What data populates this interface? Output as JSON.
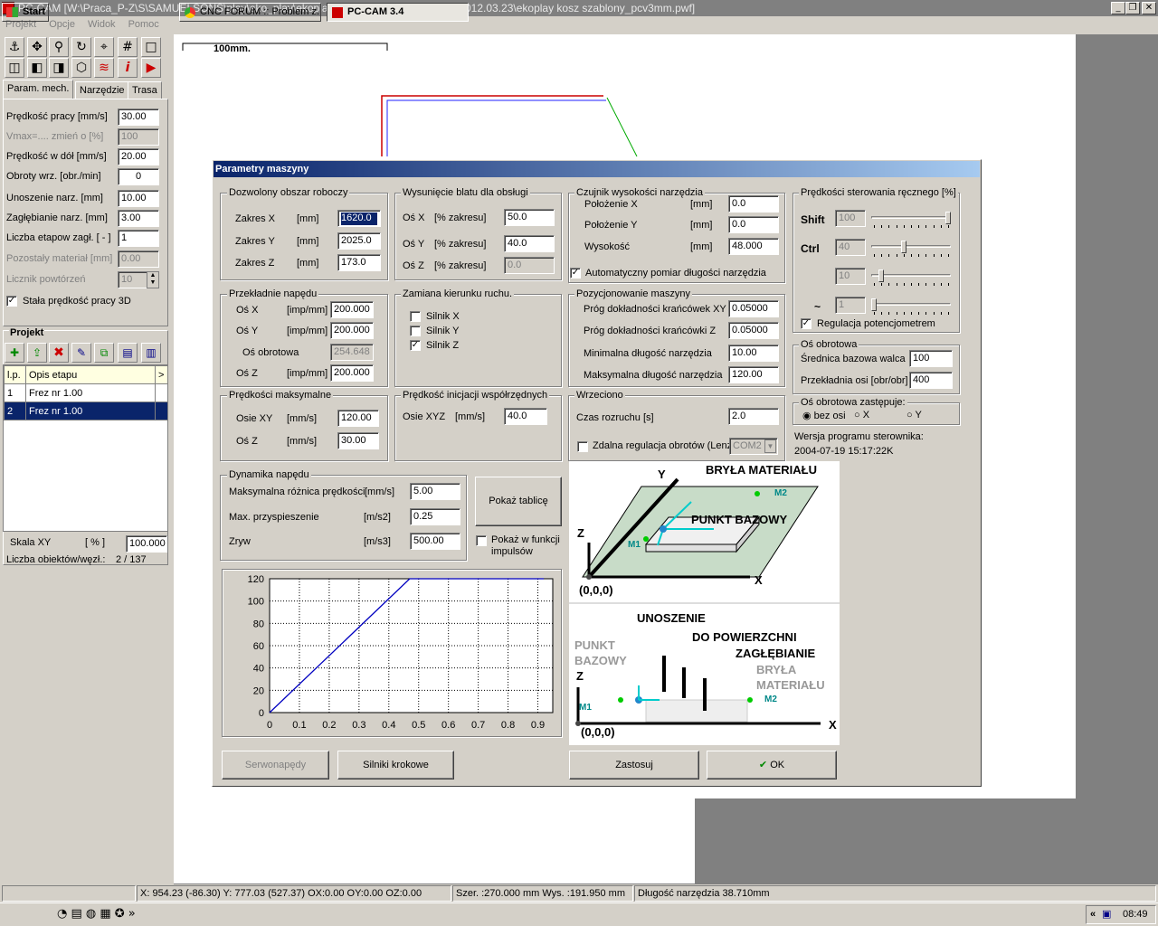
{
  "window": {
    "title": "PC-CAM  [W:\\Praca_P-Z\\S\\SAMUELSONS\\play\\eko_play\\ekoplay_kosz_dibond\\frezowanie\\2012.03.23\\ekoplay kosz szablony_pcv3mm.pwf]"
  },
  "menu": [
    "Projekt",
    "Opcje",
    "Widok",
    "Pomoc"
  ],
  "left_tabs": [
    "Param. mech.",
    "Narzędzie",
    "Trasa"
  ],
  "params": [
    {
      "label": "Prędkość pracy   [mm/s]",
      "value": "30.00",
      "disabled": false
    },
    {
      "label": "Vmax=....   zmień o [%]",
      "value": "100",
      "disabled": true
    },
    {
      "label": "Prędkość w dół   [mm/s]",
      "value": "20.00",
      "disabled": false
    },
    {
      "label": "Obroty wrz.   [obr./min]",
      "value": "0",
      "disabled": false
    },
    {
      "label": "Unoszenie narz.    [mm]",
      "value": "10.00",
      "disabled": false
    },
    {
      "label": "Zagłębianie narz.   [mm]",
      "value": "3.00",
      "disabled": false
    },
    {
      "label": "Liczba etapow zagł. [ - ]",
      "value": "1",
      "disabled": false
    },
    {
      "label": "Pozostały materiał  [mm]",
      "value": "0.00",
      "disabled": true
    },
    {
      "label": "Licznik powtórzeń",
      "value": "10",
      "disabled": true
    }
  ],
  "const_speed_label": "Stała prędkość pracy 3D",
  "project": {
    "title": "Projekt",
    "col_lp": "l.p.",
    "col_desc": "Opis etapu",
    "col_more": ">",
    "rows": [
      {
        "lp": "1",
        "desc": "Frez nr 1.00"
      },
      {
        "lp": "2",
        "desc": "Frez nr 1.00"
      }
    ]
  },
  "scale": {
    "label": "Skala XY",
    "unit": "[ % ]",
    "value": "100.000"
  },
  "objects": {
    "label": "Liczba obiektów/węzł.:",
    "value": "2 /    137"
  },
  "ruler": "100mm.",
  "dialog": {
    "title": "Parametry maszyny",
    "workarea": {
      "title": "Dozwolony obszar roboczy",
      "rows": [
        {
          "label": "Zakres X",
          "unit": "[mm]",
          "value": "1620.0"
        },
        {
          "label": "Zakres Y",
          "unit": "[mm]",
          "value": "2025.0"
        },
        {
          "label": "Zakres Z",
          "unit": "[mm]",
          "value": "173.0"
        }
      ]
    },
    "table": {
      "title": "Wysunięcie blatu dla obsługi",
      "rows": [
        {
          "label": "Oś X",
          "unit": "[% zakresu]",
          "value": "50.0",
          "disabled": false
        },
        {
          "label": "Oś Y",
          "unit": "[% zakresu]",
          "value": "40.0",
          "disabled": false
        },
        {
          "label": "Oś Z",
          "unit": "[% zakresu]",
          "value": "0.0",
          "disabled": true
        }
      ]
    },
    "sensor": {
      "title": "Czujnik wysokości narzędzia",
      "rows": [
        {
          "label": "Położenie X",
          "unit": "[mm]",
          "value": "0.0"
        },
        {
          "label": "Położenie Y",
          "unit": "[mm]",
          "value": "0.0"
        },
        {
          "label": "Wysokość",
          "unit": "[mm]",
          "value": "48.000"
        }
      ],
      "auto_label": "Automatyczny pomiar długości narzędzia"
    },
    "manual": {
      "title": "Prędkości sterowania ręcznego [%]",
      "rows": [
        {
          "label": "Shift",
          "value": "100",
          "pos": 1.0
        },
        {
          "label": "Ctrl",
          "value": "40",
          "pos": 0.4
        },
        {
          "label": "",
          "value": "10",
          "pos": 0.1
        },
        {
          "label": "~",
          "value": "1",
          "pos": 0.0
        }
      ],
      "pot_label": "Regulacja potencjometrem"
    },
    "gears": {
      "title": "Przekładnie napędu",
      "rows": [
        {
          "label": "Oś X",
          "unit": "[imp/mm]",
          "value": "200.000",
          "disabled": false
        },
        {
          "label": "Oś Y",
          "unit": "[imp/mm]",
          "value": "200.000",
          "disabled": false
        },
        {
          "label": "Oś obrotowa",
          "unit": "",
          "value": "254.648",
          "disabled": true
        },
        {
          "label": "Oś Z",
          "unit": "[imp/mm]",
          "value": "200.000",
          "disabled": false
        }
      ]
    },
    "direction": {
      "title": "Zamiana kierunku ruchu.",
      "items": [
        {
          "label": "Silnik X",
          "checked": false
        },
        {
          "label": "Silnik Y",
          "checked": false
        },
        {
          "label": "Silnik Z",
          "checked": true
        }
      ]
    },
    "positioning": {
      "title": "Pozycjonowanie maszyny",
      "rows": [
        {
          "label": "Próg dokładności krańcówek XY",
          "value": "0.05000"
        },
        {
          "label": "Próg dokładności krańcówki Z",
          "value": "0.05000"
        },
        {
          "label": "Minimalna długość narzędzia",
          "value": "10.00"
        },
        {
          "label": "Maksymalna długość narzędzia",
          "value": "120.00"
        }
      ]
    },
    "rot_axis": {
      "title": "Oś obrotowa",
      "rows": [
        {
          "label": "Średnica bazowa walca",
          "value": "100"
        },
        {
          "label": "Przekładnia osi [obr/obr]",
          "value": "400"
        }
      ]
    },
    "rot_replace": {
      "title": "Oś obrotowa zastępuje:",
      "options": [
        "bez osi",
        "X",
        "Y"
      ],
      "selected": 0
    },
    "version": {
      "label": "Wersja programu sterownika:",
      "value": "2004-07-19 15:17:22K"
    },
    "maxspeed": {
      "title": "Prędkości maksymalne",
      "rows": [
        {
          "label": "Osie XY",
          "unit": "[mm/s]",
          "value": "120.00"
        },
        {
          "label": "Oś Z",
          "unit": "[mm/s]",
          "value": "30.00"
        }
      ]
    },
    "initspeed": {
      "title": "Prędkość inicjacji współrzędnych",
      "label": "Osie XYZ",
      "unit": "[mm/s]",
      "value": "40.0"
    },
    "spindle": {
      "title": "Wrzeciono",
      "runup_label": "Czas rozruchu [s]",
      "runup_value": "2.0",
      "remote_label": "Zdalna regulacja obrotów (Lenz",
      "port": "COM2"
    },
    "dynamics": {
      "title": "Dynamika napędu",
      "rows": [
        {
          "label": "Maksymalna różnica prędkości",
          "unit": "[mm/s]",
          "value": "5.00"
        },
        {
          "label": "Max. przyspieszenie",
          "unit": "[m/s2]",
          "value": "0.25"
        },
        {
          "label": "Zryw",
          "unit": "[m/s3]",
          "value": "500.00"
        }
      ]
    },
    "show_table": "Pokaż tablicę",
    "show_func": "Pokaż w funkcji impulsów",
    "buttons": {
      "servo": "Serwonapędy",
      "stepper": "Silniki krokowe",
      "apply": "Zastosuj",
      "ok": "OK"
    },
    "diagram_top": {
      "y": "Y",
      "x": "X",
      "z": "Z",
      "origin": "(0,0,0)",
      "brick": "BRYŁA MATERIAŁU",
      "base": "PUNKT BAZOWY",
      "m1": "M1",
      "m2": "M2"
    },
    "diagram_bottom": {
      "lift": "UNOSZENIE",
      "surface": "DO POWIERZCHNI",
      "plunge": "ZAGŁĘBIANIE",
      "base1": "PUNKT",
      "base2": "BAZOWY",
      "brick1": "BRYŁA",
      "brick2": "MATERIAŁU",
      "z": "Z",
      "x": "X",
      "origin": "(0,0,0)",
      "m1": "M1",
      "m2": "M2"
    }
  },
  "chart_data": {
    "type": "line",
    "x": [
      0,
      0.47,
      0.92
    ],
    "y": [
      0,
      120,
      120
    ],
    "xlim": [
      0,
      0.95
    ],
    "ylim": [
      0,
      120
    ],
    "xticks": [
      "0",
      "0.1",
      "0.2",
      "0.3",
      "0.4",
      "0.5",
      "0.6",
      "0.7",
      "0.8",
      "0.9"
    ],
    "yticks": [
      "0",
      "20",
      "40",
      "60",
      "80",
      "100",
      "120"
    ],
    "grid": true,
    "color": "#0000c0"
  },
  "status": {
    "coords": "X: 954.23 (-86.30)  Y: 777.03 (527.37) OX:0.00 OY:0.00 OZ:0.00",
    "size": "Szer. :270.000 mm   Wys. :191.950 mm",
    "tool": "Długość narzędzia  38.710mm"
  },
  "taskbar": {
    "start": "Start",
    "task1": "CNC FORUM :: Problem z...",
    "task2": "PC-CAM 3.4",
    "clock": "08:49",
    "expand": "«"
  }
}
